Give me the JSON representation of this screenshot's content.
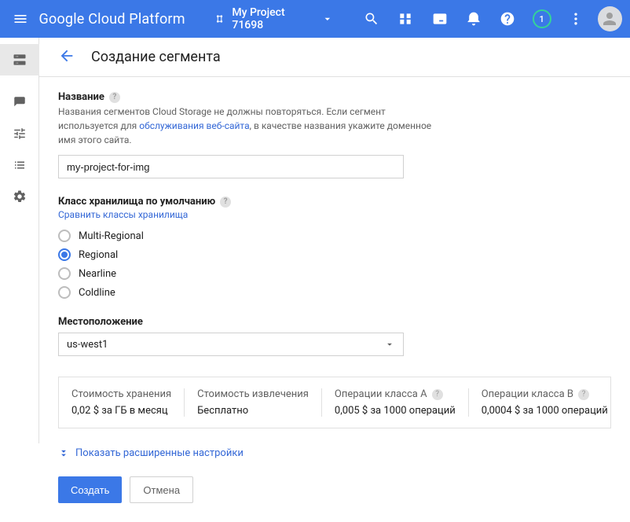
{
  "topbar": {
    "brand": "Google Cloud Platform",
    "project_label": "My Project 71698",
    "notif_count": "1"
  },
  "header": {
    "title": "Создание сегмента"
  },
  "name_section": {
    "label": "Название",
    "desc_before": "Названия сегментов Cloud Storage не должны повторяться. Если сегмент используется для ",
    "desc_link": "обслуживания веб-сайта",
    "desc_after": ", в качестве названия укажите доменное имя этого сайта.",
    "value": "my-project-for-img"
  },
  "class_section": {
    "label": "Класс хранилища по умолчанию",
    "compare_link": "Сравнить классы хранилища",
    "options": [
      "Multi-Regional",
      "Regional",
      "Nearline",
      "Coldline"
    ],
    "selected_index": 1
  },
  "location_section": {
    "label": "Местоположение",
    "value": "us-west1"
  },
  "pricing": [
    {
      "label": "Стоимость хранения",
      "value": "0,02 $ за ГБ в месяц"
    },
    {
      "label": "Стоимость извлечения",
      "value": "Бесплатно"
    },
    {
      "label": "Операции класса А",
      "value": "0,005 $ за 1000 операций"
    },
    {
      "label": "Операции класса B",
      "value": "0,0004 $ за 1000 операций"
    }
  ],
  "advanced_label": "Показать расширенные настройки",
  "actions": {
    "create": "Создать",
    "cancel": "Отмена"
  }
}
